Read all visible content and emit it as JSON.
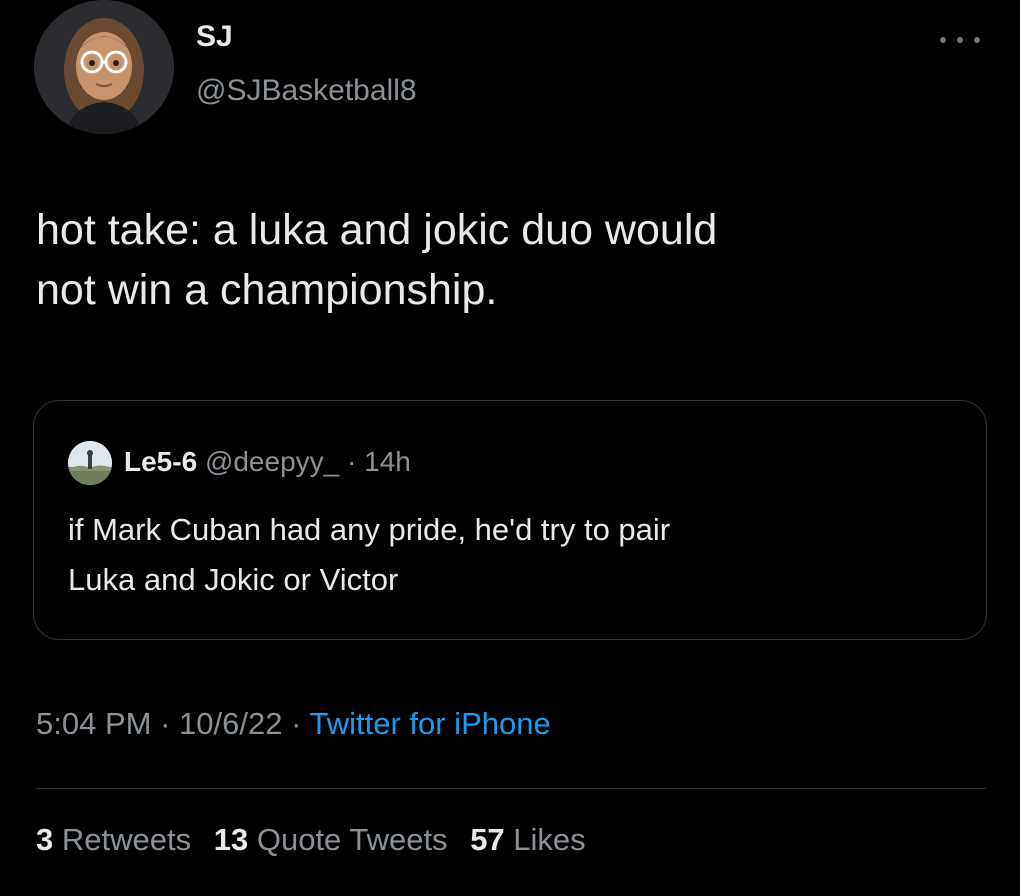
{
  "author": {
    "display_name": "SJ",
    "handle": "@SJBasketball8",
    "avatar_icon": "memoji-avatar-icon"
  },
  "tweet": {
    "text_lines": [
      "hot take: a luka and jokic duo would",
      "not win a championship."
    ]
  },
  "quoted_tweet": {
    "display_name": "Le5-6",
    "handle": "@deepyy_",
    "separator": "·",
    "time": "14h",
    "avatar_icon": "landscape-photo-avatar-icon",
    "text_lines": [
      "if Mark Cuban had any pride, he'd try to pair",
      "Luka and Jokic or Victor"
    ]
  },
  "meta": {
    "time": "5:04 PM",
    "sep1": "·",
    "date": "10/6/22",
    "sep2": "·",
    "source": "Twitter for iPhone"
  },
  "stats": {
    "retweets_count": "3",
    "retweets_label": "Retweets",
    "quotes_count": "13",
    "quotes_label": "Quote Tweets",
    "likes_count": "57",
    "likes_label": "Likes"
  },
  "colors": {
    "background": "#000000",
    "primary_text": "#e7e9ea",
    "secondary_text": "#8b9196",
    "link": "#1d9bf0",
    "border": "#2f3336"
  },
  "icons": {
    "more": "more-options-icon"
  }
}
